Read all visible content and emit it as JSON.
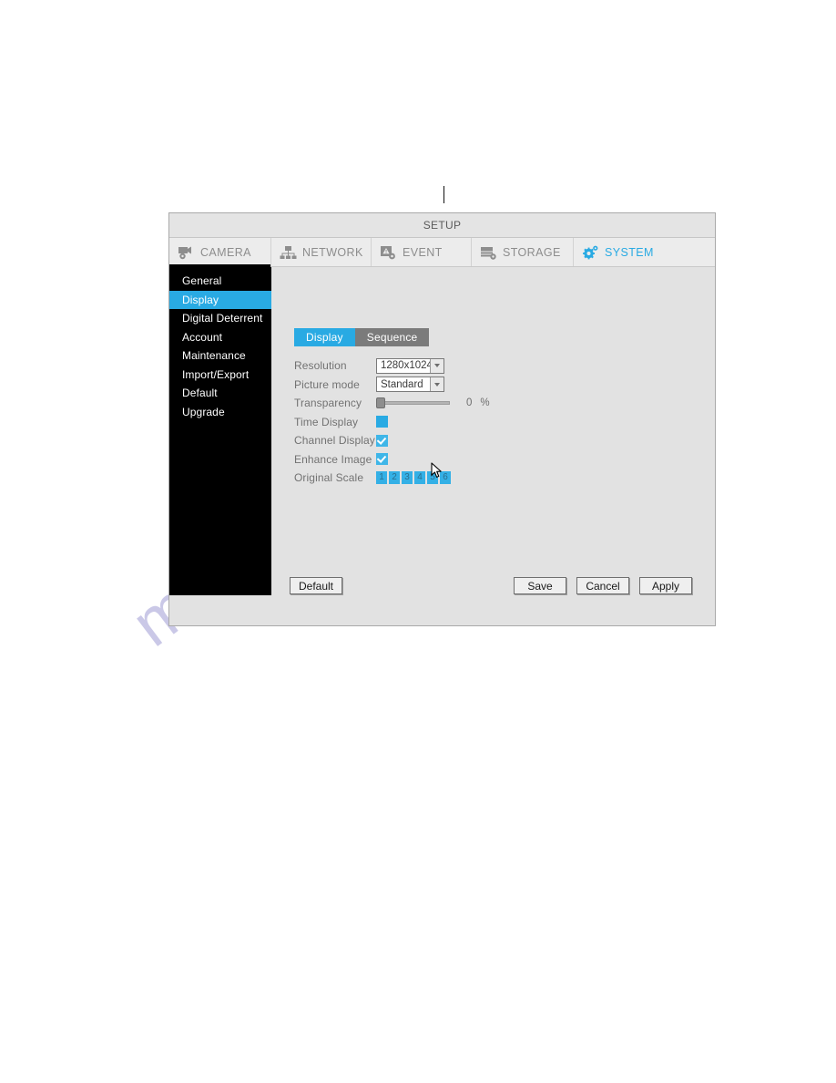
{
  "dialog": {
    "title": "SETUP"
  },
  "top_tabs": [
    {
      "label": "CAMERA",
      "icon": "camera-icon",
      "active": false
    },
    {
      "label": "NETWORK",
      "icon": "network-icon",
      "active": false
    },
    {
      "label": "EVENT",
      "icon": "event-icon",
      "active": false
    },
    {
      "label": "STORAGE",
      "icon": "storage-icon",
      "active": false
    },
    {
      "label": "SYSTEM",
      "icon": "gear-icon",
      "active": true
    }
  ],
  "sidebar": {
    "items": [
      {
        "label": "General",
        "selected": false
      },
      {
        "label": "Display",
        "selected": true
      },
      {
        "label": "Digital Deterrent",
        "selected": false
      },
      {
        "label": "Account",
        "selected": false
      },
      {
        "label": "Maintenance",
        "selected": false
      },
      {
        "label": "Import/Export",
        "selected": false
      },
      {
        "label": "Default",
        "selected": false
      },
      {
        "label": "Upgrade",
        "selected": false
      }
    ]
  },
  "sub_tabs": [
    {
      "label": "Display",
      "active": true
    },
    {
      "label": "Sequence",
      "active": false
    }
  ],
  "form": {
    "resolution": {
      "label": "Resolution",
      "value": "1280x1024"
    },
    "picture_mode": {
      "label": "Picture mode",
      "value": "Standard"
    },
    "transparency": {
      "label": "Transparency",
      "value": "0",
      "unit": "%",
      "percent": 0
    },
    "time_display": {
      "label": "Time Display",
      "checked": false
    },
    "channel_display": {
      "label": "Channel Display",
      "checked": true
    },
    "enhance_image": {
      "label": "Enhance Image",
      "checked": true
    },
    "original_scale": {
      "label": "Original Scale",
      "channels": [
        "1",
        "2",
        "3",
        "4",
        "5",
        "6"
      ]
    }
  },
  "buttons": {
    "default": "Default",
    "save": "Save",
    "cancel": "Cancel",
    "apply": "Apply"
  },
  "colors": {
    "accent": "#29aae3",
    "sidebar_bg": "#000000",
    "dialog_bg": "#e2e2e2",
    "inactive_tab": "#7b7b7b",
    "label_text": "#727272",
    "watermark": "#b7b4de"
  },
  "watermark": {
    "text": "manualshive.com"
  }
}
